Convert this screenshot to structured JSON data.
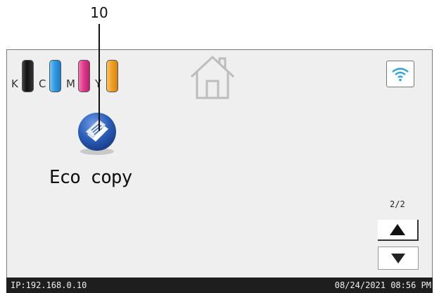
{
  "callout": {
    "number": "10"
  },
  "ink": {
    "cartridges": [
      {
        "letter": "K",
        "color": "#1b1b1b"
      },
      {
        "letter": "C",
        "color": "#2f9be4"
      },
      {
        "letter": "M",
        "color": "#e23c8f"
      },
      {
        "letter": "Y",
        "color": "#f2a024"
      }
    ]
  },
  "icons": {
    "home": "home-icon",
    "wifi": "wifi-icon",
    "app": "eco-copy-icon"
  },
  "app": {
    "label": "Eco copy"
  },
  "pager": {
    "indicator": "2/2"
  },
  "status": {
    "ip": "IP:192.168.0.10",
    "datetime": "08/24/2021 08:56 PM"
  },
  "colors": {
    "status_bar": "#1e1e1e",
    "screen": "#efefef",
    "app_icon": "#2a5db8"
  }
}
